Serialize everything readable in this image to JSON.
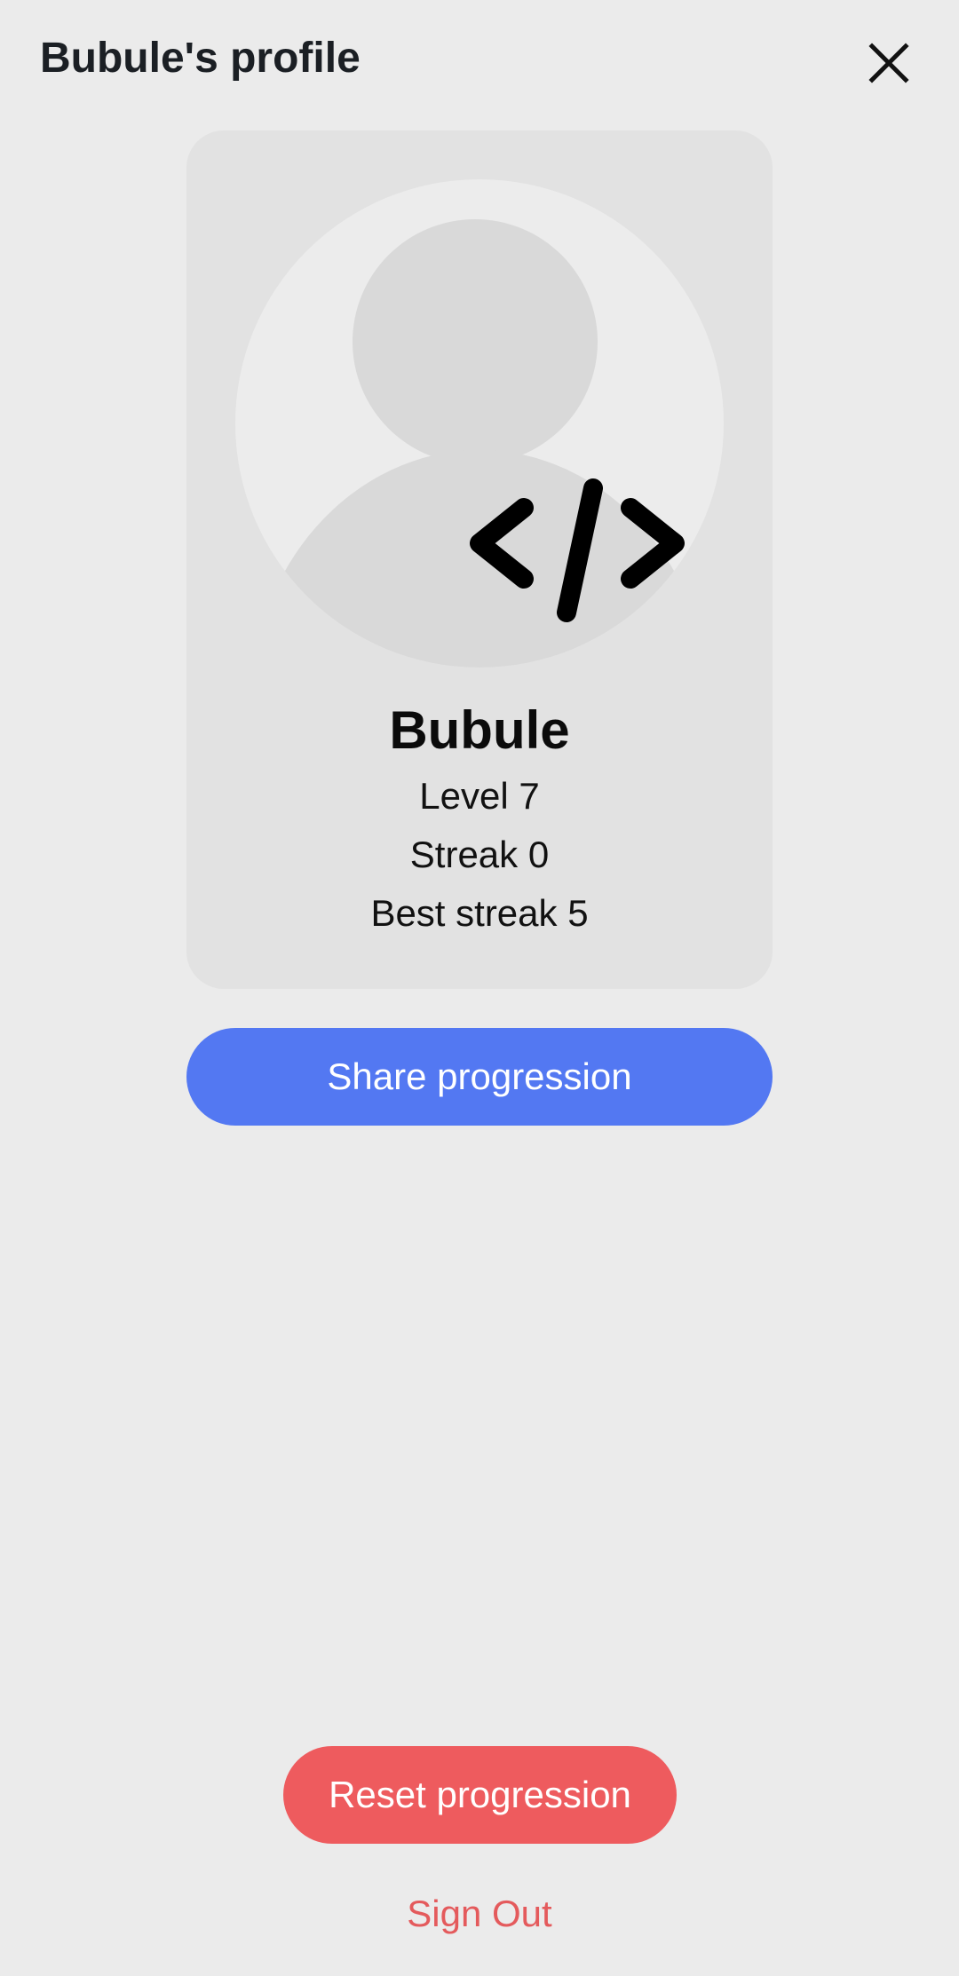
{
  "header": {
    "title": "Bubule's profile",
    "close_icon": "close-icon"
  },
  "profile": {
    "avatar_icon": "default-avatar-icon",
    "badge_icon": "code-brackets-icon",
    "name": "Bubule",
    "level": "Level 7",
    "streak": "Streak 0",
    "best_streak": "Best streak 5"
  },
  "actions": {
    "share_label": "Share progression",
    "reset_label": "Reset progression",
    "signout_label": "Sign Out"
  },
  "colors": {
    "background": "#ebebeb",
    "card": "#e2e2e2",
    "share_button": "#5378f2",
    "reset_button": "#ee5b5e",
    "signout_text": "#e45a5c"
  }
}
